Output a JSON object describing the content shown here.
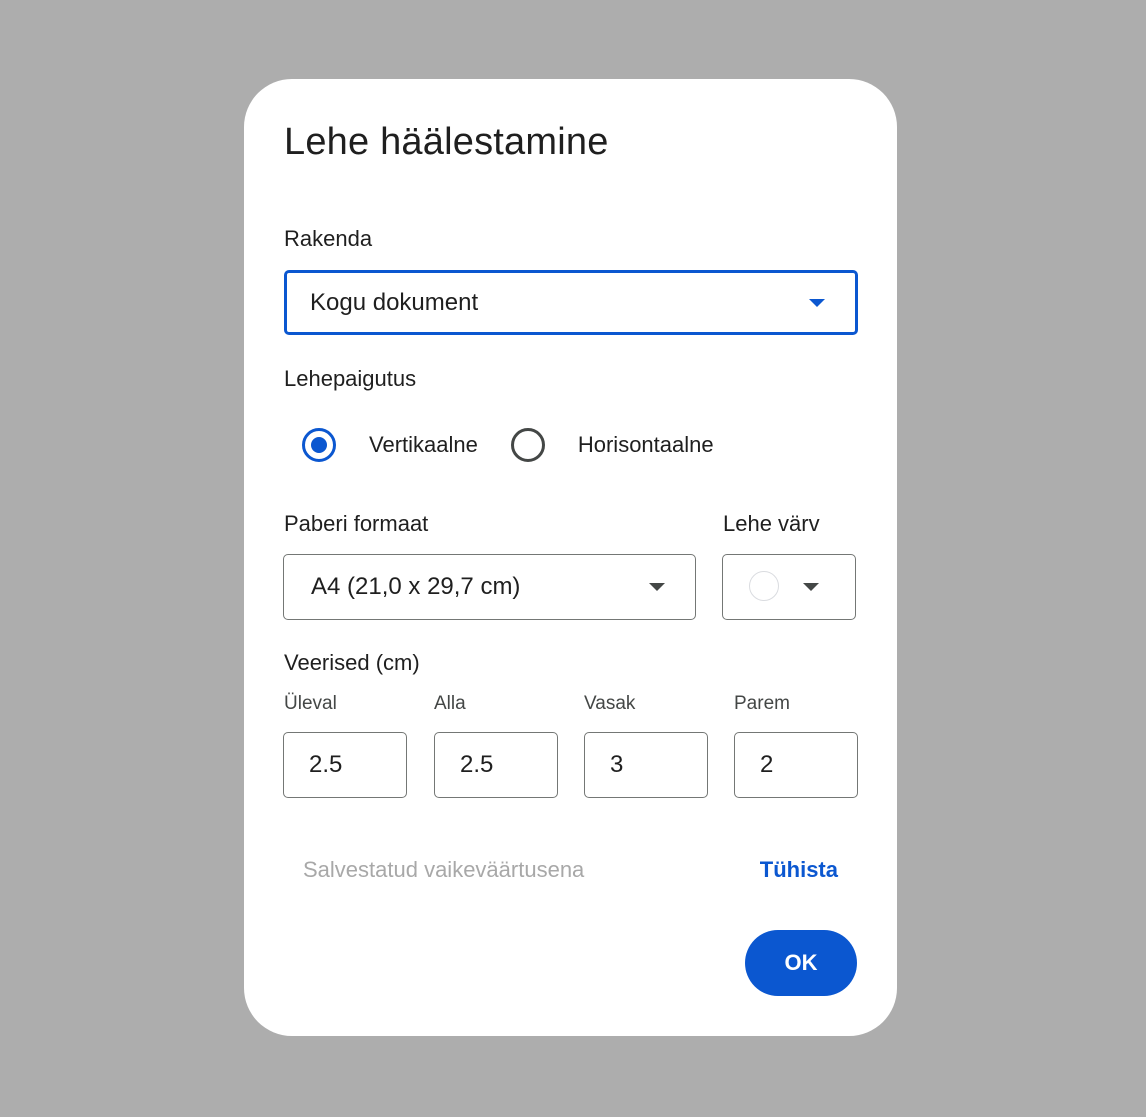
{
  "dialog": {
    "title": "Lehe häälestamine"
  },
  "apply": {
    "label": "Rakenda",
    "selected": "Kogu dokument"
  },
  "orientation": {
    "label": "Lehepaigutus",
    "options": [
      {
        "label": "Vertikaalne",
        "checked": true
      },
      {
        "label": "Horisontaalne",
        "checked": false
      }
    ]
  },
  "paper_size": {
    "label": "Paberi formaat",
    "selected": "A4 (21,0 x 29,7 cm)"
  },
  "page_color": {
    "label": "Lehe värv",
    "value": "#ffffff"
  },
  "margins": {
    "label": "Veerised (cm)",
    "fields": [
      {
        "label": "Üleval",
        "value": "2.5"
      },
      {
        "label": "Alla",
        "value": "2.5"
      },
      {
        "label": "Vasak",
        "value": "3"
      },
      {
        "label": "Parem",
        "value": "2"
      }
    ]
  },
  "footer": {
    "save_default": "Salvestatud vaikeväärtusena",
    "cancel": "Tühista",
    "ok": "OK"
  },
  "colors": {
    "accent": "#0b57d0",
    "backdrop": "#adadad",
    "disabled_text": "#a8a8a8"
  },
  "icons": {
    "dropdown": "caret-down-icon",
    "radio_checked": "radio-checked-icon",
    "radio_unchecked": "radio-unchecked-icon"
  }
}
